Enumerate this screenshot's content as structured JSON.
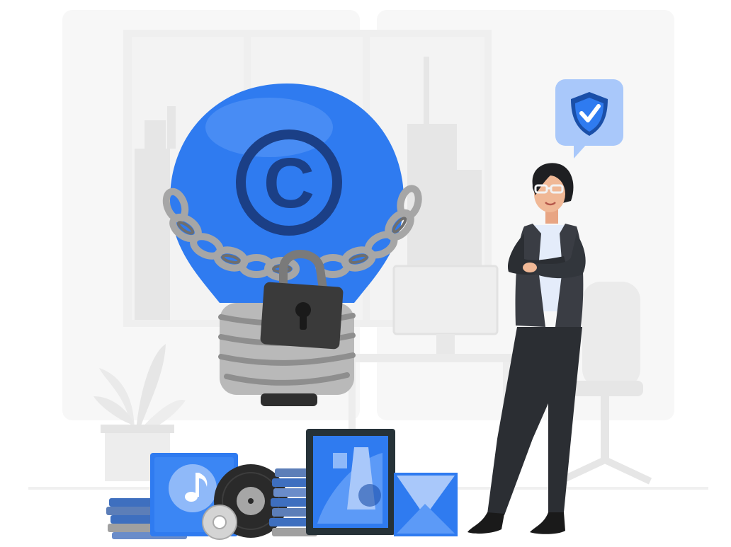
{
  "illustration": {
    "copyright_symbol": "C"
  },
  "colors": {
    "accent": "#2F7BF0",
    "accent_dark": "#1A4FA8",
    "accent_light": "#5C9AF7",
    "navy": "#1B3F86",
    "chain": "#A6A6A6",
    "chain_dark": "#6E6E6E",
    "lock": "#3A3A3A",
    "suit": "#2B2E33",
    "background_gray": "#F4F4F4"
  },
  "icons": [
    "copyright-icon",
    "padlock-icon",
    "shield-check-icon",
    "music-note-icon",
    "vinyl-record-icon",
    "cd-disc-icon",
    "plant-icon"
  ]
}
